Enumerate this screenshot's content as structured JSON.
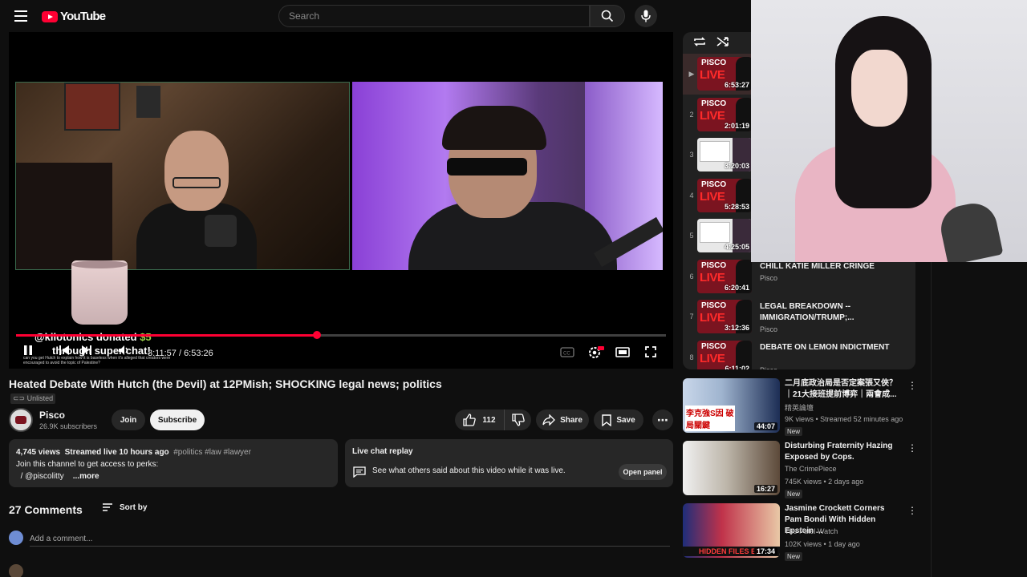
{
  "header": {
    "logo_text": "YouTube",
    "search_placeholder": "Search"
  },
  "player": {
    "current_time": "3:11:57",
    "total_time": "6:53:26",
    "time_separator": " / ",
    "progress_fraction": 0.4626,
    "donation_user": "@kilotonics",
    "donation_verb": "donated",
    "donation_amount": "$5",
    "donation_line2": "through super chat!",
    "small_note": "can you get Hutch to explain how it is baseless when it's alleged that creators were encouraged to avoid the topic of Palestine?",
    "cup_caption": ""
  },
  "video": {
    "title": "Heated Debate With Hutch (the Devil) at 12PMish; SHOCKING legal news; politics",
    "unlisted_label": "Unlisted",
    "channel_name": "Pisco",
    "subscribers": "26.9K subscribers",
    "join_label": "Join",
    "subscribe_label": "Subscribe",
    "like_count": "112",
    "share_label": "Share",
    "save_label": "Save"
  },
  "description": {
    "views": "4,745 views",
    "streamed": "Streamed live 10 hours ago",
    "tags": "#politics #law #lawyer",
    "line2": "Join this channel to get access to perks:",
    "line3": "/ @piscolitty",
    "more": "...more"
  },
  "live_chat": {
    "title": "Live chat replay",
    "text": "See what others said about this video while it was live.",
    "open_panel_label": "Open panel"
  },
  "comments": {
    "count_label": "27 Comments",
    "sort_label": "Sort by",
    "add_placeholder": "Add a comment..."
  },
  "playlist": {
    "items": [
      {
        "index": "",
        "duration": "6:53:27",
        "title": "",
        "channel": ""
      },
      {
        "index": "2",
        "duration": "2:01:19",
        "title": "",
        "channel": ""
      },
      {
        "index": "3",
        "duration": "3:20:03",
        "title": "",
        "channel": ""
      },
      {
        "index": "4",
        "duration": "5:28:53",
        "title": "",
        "channel": ""
      },
      {
        "index": "5",
        "duration": "4:25:05",
        "title": "",
        "channel": ""
      },
      {
        "index": "6",
        "duration": "6:20:41",
        "title": "CHILL KATIE MILLER CRINGE",
        "channel": "Pisco"
      },
      {
        "index": "7",
        "duration": "3:12:36",
        "title": "LEGAL BREAKDOWN -- IMMIGRATION/TRUMP;...",
        "channel": "Pisco"
      },
      {
        "index": "8",
        "duration": "6:11:02",
        "title": "DEBATE ON LEMON INDICTMENT",
        "channel": "Pisco"
      }
    ],
    "thumb_brand": "PISCO",
    "thumb_live": "LIVE"
  },
  "recommendations": [
    {
      "title": "二月底政治局是否定案張又俠？｜21大接班提前博弈｜兩會成...",
      "channel": "精英論壇",
      "stats": "9K views • Streamed 52 minutes ago",
      "badge": "New",
      "duration": "44:07",
      "thumb_text": "李克強S因 破局關鍵"
    },
    {
      "title": "Disturbing Fraternity Hazing Exposed by Cops.",
      "channel": "The CrimePiece",
      "stats": "745K views • 2 days ago",
      "badge": "New",
      "duration": "16:27",
      "thumb_text": ""
    },
    {
      "title": "Jasmine Crockett Corners Pam Bondi With Hidden Epstein ...",
      "channel": "The Patel Watch",
      "stats": "102K views • 1 day ago",
      "badge": "New",
      "duration": "17:34",
      "thumb_text": "HIDDEN FILES EX"
    }
  ],
  "colors": {
    "accent": "#ff0033",
    "background": "#0f0f0f",
    "surface": "#272727"
  }
}
